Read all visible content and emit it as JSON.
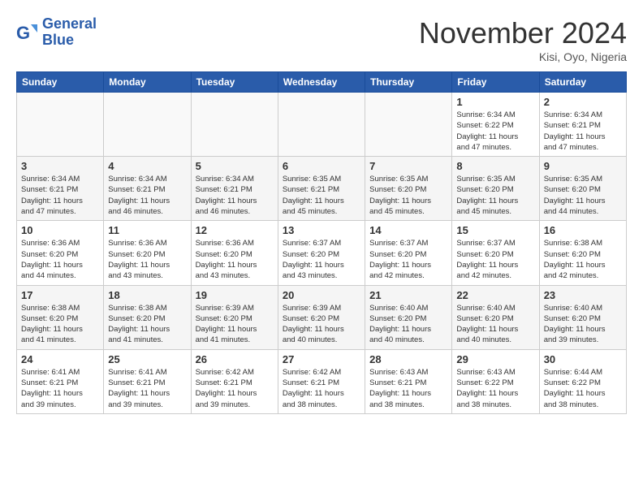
{
  "header": {
    "logo_line1": "General",
    "logo_line2": "Blue",
    "month_title": "November 2024",
    "location": "Kisi, Oyo, Nigeria"
  },
  "days_of_week": [
    "Sunday",
    "Monday",
    "Tuesday",
    "Wednesday",
    "Thursday",
    "Friday",
    "Saturday"
  ],
  "weeks": [
    [
      {
        "day": "",
        "info": ""
      },
      {
        "day": "",
        "info": ""
      },
      {
        "day": "",
        "info": ""
      },
      {
        "day": "",
        "info": ""
      },
      {
        "day": "",
        "info": ""
      },
      {
        "day": "1",
        "info": "Sunrise: 6:34 AM\nSunset: 6:22 PM\nDaylight: 11 hours and 47 minutes."
      },
      {
        "day": "2",
        "info": "Sunrise: 6:34 AM\nSunset: 6:21 PM\nDaylight: 11 hours and 47 minutes."
      }
    ],
    [
      {
        "day": "3",
        "info": "Sunrise: 6:34 AM\nSunset: 6:21 PM\nDaylight: 11 hours and 47 minutes."
      },
      {
        "day": "4",
        "info": "Sunrise: 6:34 AM\nSunset: 6:21 PM\nDaylight: 11 hours and 46 minutes."
      },
      {
        "day": "5",
        "info": "Sunrise: 6:34 AM\nSunset: 6:21 PM\nDaylight: 11 hours and 46 minutes."
      },
      {
        "day": "6",
        "info": "Sunrise: 6:35 AM\nSunset: 6:21 PM\nDaylight: 11 hours and 45 minutes."
      },
      {
        "day": "7",
        "info": "Sunrise: 6:35 AM\nSunset: 6:20 PM\nDaylight: 11 hours and 45 minutes."
      },
      {
        "day": "8",
        "info": "Sunrise: 6:35 AM\nSunset: 6:20 PM\nDaylight: 11 hours and 45 minutes."
      },
      {
        "day": "9",
        "info": "Sunrise: 6:35 AM\nSunset: 6:20 PM\nDaylight: 11 hours and 44 minutes."
      }
    ],
    [
      {
        "day": "10",
        "info": "Sunrise: 6:36 AM\nSunset: 6:20 PM\nDaylight: 11 hours and 44 minutes."
      },
      {
        "day": "11",
        "info": "Sunrise: 6:36 AM\nSunset: 6:20 PM\nDaylight: 11 hours and 43 minutes."
      },
      {
        "day": "12",
        "info": "Sunrise: 6:36 AM\nSunset: 6:20 PM\nDaylight: 11 hours and 43 minutes."
      },
      {
        "day": "13",
        "info": "Sunrise: 6:37 AM\nSunset: 6:20 PM\nDaylight: 11 hours and 43 minutes."
      },
      {
        "day": "14",
        "info": "Sunrise: 6:37 AM\nSunset: 6:20 PM\nDaylight: 11 hours and 42 minutes."
      },
      {
        "day": "15",
        "info": "Sunrise: 6:37 AM\nSunset: 6:20 PM\nDaylight: 11 hours and 42 minutes."
      },
      {
        "day": "16",
        "info": "Sunrise: 6:38 AM\nSunset: 6:20 PM\nDaylight: 11 hours and 42 minutes."
      }
    ],
    [
      {
        "day": "17",
        "info": "Sunrise: 6:38 AM\nSunset: 6:20 PM\nDaylight: 11 hours and 41 minutes."
      },
      {
        "day": "18",
        "info": "Sunrise: 6:38 AM\nSunset: 6:20 PM\nDaylight: 11 hours and 41 minutes."
      },
      {
        "day": "19",
        "info": "Sunrise: 6:39 AM\nSunset: 6:20 PM\nDaylight: 11 hours and 41 minutes."
      },
      {
        "day": "20",
        "info": "Sunrise: 6:39 AM\nSunset: 6:20 PM\nDaylight: 11 hours and 40 minutes."
      },
      {
        "day": "21",
        "info": "Sunrise: 6:40 AM\nSunset: 6:20 PM\nDaylight: 11 hours and 40 minutes."
      },
      {
        "day": "22",
        "info": "Sunrise: 6:40 AM\nSunset: 6:20 PM\nDaylight: 11 hours and 40 minutes."
      },
      {
        "day": "23",
        "info": "Sunrise: 6:40 AM\nSunset: 6:20 PM\nDaylight: 11 hours and 39 minutes."
      }
    ],
    [
      {
        "day": "24",
        "info": "Sunrise: 6:41 AM\nSunset: 6:21 PM\nDaylight: 11 hours and 39 minutes."
      },
      {
        "day": "25",
        "info": "Sunrise: 6:41 AM\nSunset: 6:21 PM\nDaylight: 11 hours and 39 minutes."
      },
      {
        "day": "26",
        "info": "Sunrise: 6:42 AM\nSunset: 6:21 PM\nDaylight: 11 hours and 39 minutes."
      },
      {
        "day": "27",
        "info": "Sunrise: 6:42 AM\nSunset: 6:21 PM\nDaylight: 11 hours and 38 minutes."
      },
      {
        "day": "28",
        "info": "Sunrise: 6:43 AM\nSunset: 6:21 PM\nDaylight: 11 hours and 38 minutes."
      },
      {
        "day": "29",
        "info": "Sunrise: 6:43 AM\nSunset: 6:22 PM\nDaylight: 11 hours and 38 minutes."
      },
      {
        "day": "30",
        "info": "Sunrise: 6:44 AM\nSunset: 6:22 PM\nDaylight: 11 hours and 38 minutes."
      }
    ]
  ]
}
